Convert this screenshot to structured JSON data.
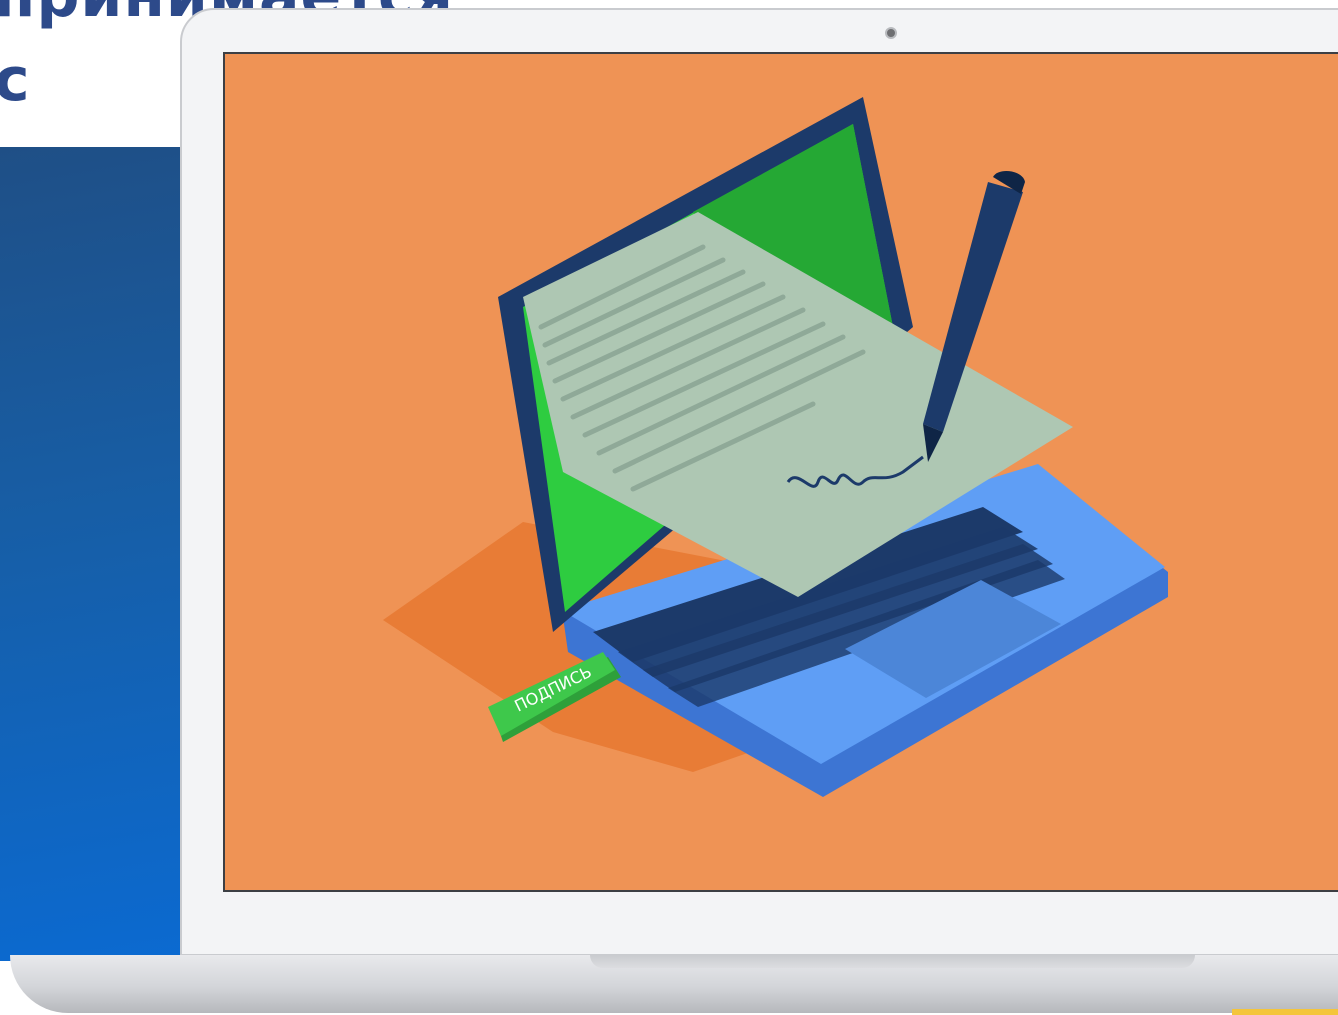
{
  "heading": {
    "lines": [
      "принимается",
      "с"
    ]
  },
  "illustration": {
    "token_label": "ПОДПИСЬ",
    "icon": "laptop-signing-illustration"
  },
  "colors": {
    "heading": "#2d4a8a",
    "panel_top": "#1f4f86",
    "panel_bottom": "#0b6ad1",
    "screen_background": "#ef9355",
    "token": "#3ec84b",
    "laptop_body": "#5f9ef5",
    "document": "#aec7b3",
    "accent_yellow": "#f4c53b"
  }
}
